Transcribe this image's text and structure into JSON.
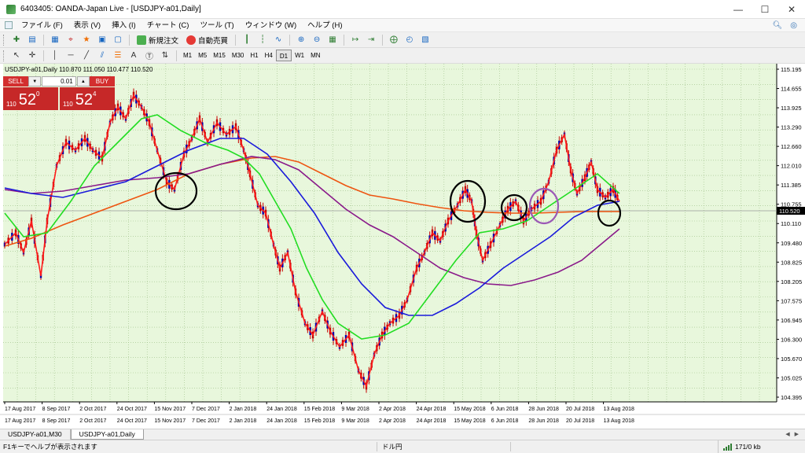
{
  "window": {
    "title": "6403405: OANDA-Japan Live - [USDJPY-a01,Daily]",
    "minimize_glyph": "—",
    "maximize_glyph": "☐",
    "close_glyph": "✕"
  },
  "menu": {
    "items": [
      "ファイル (F)",
      "表示 (V)",
      "挿入 (I)",
      "チャート (C)",
      "ツール (T)",
      "ウィンドウ (W)",
      "ヘルプ (H)"
    ]
  },
  "toolbar": {
    "new_order_label": "新規注文",
    "auto_trading_label": "自動売買",
    "timeframes": [
      "M1",
      "M5",
      "M15",
      "M30",
      "H1",
      "H4",
      "D1",
      "W1",
      "MN"
    ],
    "active_timeframe": "D1"
  },
  "chart": {
    "header": "USDJPY-a01,Daily  110.870 111.050 110.477 110.520",
    "current_price_label": "110.520",
    "price_labels": [
      "115.195",
      "114.655",
      "113.925",
      "113.290",
      "112.660",
      "112.010",
      "111.385",
      "110.755",
      "110.110",
      "109.480",
      "108.825",
      "108.205",
      "107.575",
      "106.945",
      "106.300",
      "105.670",
      "105.025",
      "104.395"
    ],
    "date_labels": [
      "17 Aug 2017",
      "8 Sep 2017",
      "2 Oct 2017",
      "24 Oct 2017",
      "15 Nov 2017",
      "7 Dec 2017",
      "2 Jan 2018",
      "24 Jan 2018",
      "15 Feb 2018",
      "9 Mar 2018",
      "2 Apr 2018",
      "24 Apr 2018",
      "15 May 2018",
      "6 Jun 2018",
      "28 Jun 2018",
      "20 Jul 2018",
      "13 Aug 2018"
    ],
    "colors": {
      "background": "#e8f7dc",
      "grid": "#9bbf86",
      "price_line": "#ff1a1a",
      "ma_green": "#22dd22",
      "ma_blue": "#1a1adb",
      "ma_purple": "#8a1a8a",
      "ma_orange": "#ee5511",
      "circle_black": "#000000",
      "circle_purple": "#9b59b6"
    }
  },
  "one_click": {
    "sell_label": "SELL",
    "buy_label": "BUY",
    "lot": "0.01",
    "sell_prefix": "110",
    "sell_big": "52",
    "sell_sup": "0",
    "buy_prefix": "110",
    "buy_big": "52",
    "buy_sup": "4"
  },
  "tabs": [
    "USDJPY-a01,M30",
    "USDJPY-a01,Daily"
  ],
  "active_tab": "USDJPY-a01,Daily",
  "status": {
    "help_text": "F1キーでヘルプが表示されます",
    "symbol_text": "ドル円",
    "connection_text": "171/0 kb"
  }
}
